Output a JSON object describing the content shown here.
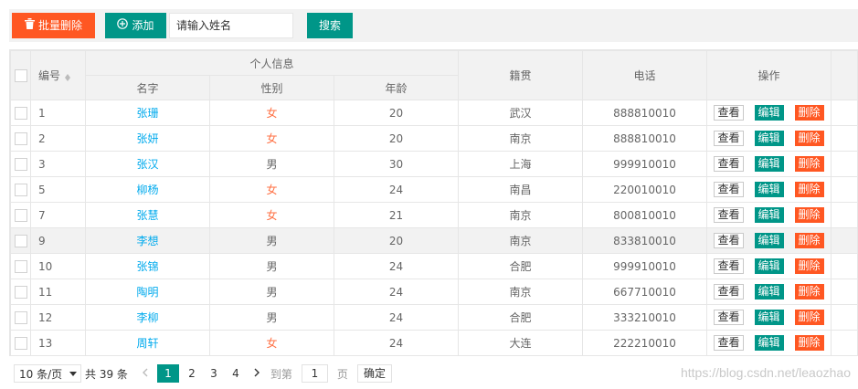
{
  "toolbar": {
    "batch_delete_label": "批量删除",
    "add_label": "添加",
    "search_placeholder": "请输入姓名",
    "search_label": "搜索"
  },
  "table": {
    "col_id": "编号",
    "group_personal": "个人信息",
    "col_name": "名字",
    "col_gender": "性别",
    "col_age": "年龄",
    "col_origin": "籍贯",
    "col_phone": "电话",
    "col_ops": "操作",
    "op_view": "查看",
    "op_edit": "编辑",
    "op_delete": "删除",
    "rows": [
      {
        "id": "1",
        "name": "张珊",
        "gender": "女",
        "age": "20",
        "origin": "武汉",
        "phone": "888810010"
      },
      {
        "id": "2",
        "name": "张妍",
        "gender": "女",
        "age": "20",
        "origin": "南京",
        "phone": "888810010"
      },
      {
        "id": "3",
        "name": "张汉",
        "gender": "男",
        "age": "30",
        "origin": "上海",
        "phone": "999910010"
      },
      {
        "id": "5",
        "name": "柳杨",
        "gender": "女",
        "age": "24",
        "origin": "南昌",
        "phone": "220010010"
      },
      {
        "id": "7",
        "name": "张慧",
        "gender": "女",
        "age": "21",
        "origin": "南京",
        "phone": "800810010"
      },
      {
        "id": "9",
        "name": "李想",
        "gender": "男",
        "age": "20",
        "origin": "南京",
        "phone": "833810010"
      },
      {
        "id": "10",
        "name": "张锦",
        "gender": "男",
        "age": "24",
        "origin": "合肥",
        "phone": "999910010"
      },
      {
        "id": "11",
        "name": "陶明",
        "gender": "男",
        "age": "24",
        "origin": "南京",
        "phone": "667710010"
      },
      {
        "id": "12",
        "name": "李柳",
        "gender": "男",
        "age": "24",
        "origin": "合肥",
        "phone": "333210010"
      },
      {
        "id": "13",
        "name": "周轩",
        "gender": "女",
        "age": "24",
        "origin": "大连",
        "phone": "222210010"
      }
    ]
  },
  "pager": {
    "page_size": "10 条/页",
    "total": "共 39 条",
    "pages": [
      "1",
      "2",
      "3",
      "4"
    ],
    "active_page": "1",
    "goto_label": "到第",
    "goto_value": "1",
    "page_unit": "页",
    "confirm_label": "确定"
  },
  "watermark": "https://blog.csdn.net/leaozhao",
  "colors": {
    "danger": "#ff5722",
    "teal": "#009688",
    "link": "#01aaed"
  }
}
